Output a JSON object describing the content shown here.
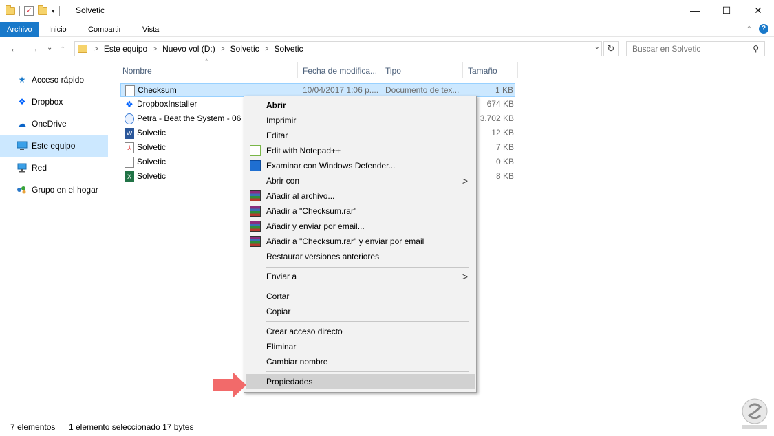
{
  "window": {
    "title": "Solvetic",
    "qat_check": "✓",
    "qat_dropdown": "▾",
    "controls": {
      "minimize": "—",
      "maximize": "☐",
      "close": "✕"
    }
  },
  "ribbon": {
    "tabs": [
      "Archivo",
      "Inicio",
      "Compartir",
      "Vista"
    ],
    "collapse_icon": "⌃",
    "help_label": "?"
  },
  "nav": {
    "back": "←",
    "forward": "→",
    "recent": "⌄",
    "up": "↑",
    "crumb_sep": ">",
    "breadcrumbs": [
      "Este equipo",
      "Nuevo vol (D:)",
      "Solvetic",
      "Solvetic"
    ],
    "dropdown": "⌄",
    "refresh": "↻",
    "search_placeholder": "Buscar en Solvetic",
    "search_icon": "⚲"
  },
  "sidebar": {
    "items": [
      {
        "label": "Acceso rápido",
        "icon": "star-icon"
      },
      {
        "label": "Dropbox",
        "icon": "dropbox-icon"
      },
      {
        "label": "OneDrive",
        "icon": "cloud-icon"
      },
      {
        "label": "Este equipo",
        "icon": "computer-icon",
        "selected": true
      },
      {
        "label": "Red",
        "icon": "network-icon"
      },
      {
        "label": "Grupo en el hogar",
        "icon": "homegroup-icon"
      }
    ]
  },
  "columns": {
    "sort_indicator": "^",
    "name": "Nombre",
    "date": "Fecha de modifica...",
    "type": "Tipo",
    "size": "Tamaño"
  },
  "files": [
    {
      "name": "Checksum",
      "date": "10/04/2017 1:06 p....",
      "type": "Documento de tex...",
      "size": "1 KB",
      "icon": "text-file-icon",
      "selected": true
    },
    {
      "name": "DropboxInstaller",
      "size": "674 KB",
      "icon": "dropbox-icon"
    },
    {
      "name": "Petra - Beat the System - 06 -",
      "size": "3.702 KB",
      "icon": "media-file-icon"
    },
    {
      "name": "Solvetic",
      "size": "12 KB",
      "icon": "word-file-icon",
      "icon_letter": "W"
    },
    {
      "name": "Solvetic",
      "size": "7 KB",
      "icon": "pdf-file-icon",
      "icon_letter": "⅄"
    },
    {
      "name": "Solvetic",
      "size": "0 KB",
      "icon": "text-file-icon"
    },
    {
      "name": "Solvetic",
      "size": "8 KB",
      "icon": "excel-file-icon",
      "icon_letter": "X"
    }
  ],
  "context_menu": {
    "submenu_arrow": ">",
    "items": [
      {
        "label": "Abrir",
        "bold": true
      },
      {
        "label": "Imprimir"
      },
      {
        "label": "Editar"
      },
      {
        "label": "Edit with Notepad++",
        "icon": "notepadpp-icon"
      },
      {
        "label": "Examinar con Windows Defender...",
        "icon": "defender-icon"
      },
      {
        "label": "Abrir con",
        "submenu": true
      },
      {
        "label": "Añadir al archivo...",
        "icon": "winrar-icon"
      },
      {
        "label": "Añadir a \"Checksum.rar\"",
        "icon": "winrar-icon"
      },
      {
        "label": "Añadir y enviar por email...",
        "icon": "winrar-icon"
      },
      {
        "label": "Añadir a \"Checksum.rar\" y enviar por email",
        "icon": "winrar-icon"
      },
      {
        "label": "Restaurar versiones anteriores"
      },
      {
        "label": "Enviar a",
        "submenu": true
      },
      {
        "label": "Cortar"
      },
      {
        "label": "Copiar"
      },
      {
        "label": "Crear acceso directo"
      },
      {
        "label": "Eliminar"
      },
      {
        "label": "Cambiar nombre"
      },
      {
        "label": "Propiedades",
        "highlighted": true
      }
    ]
  },
  "status": {
    "count": "7 elementos",
    "selection": "1 elemento seleccionado  17 bytes"
  },
  "colors": {
    "accent": "#1979ca",
    "selection": "#cce8ff",
    "menu_bg": "#f2f2f2",
    "menu_highlight": "#d1d1d1",
    "arrow": "#f26a6a"
  }
}
